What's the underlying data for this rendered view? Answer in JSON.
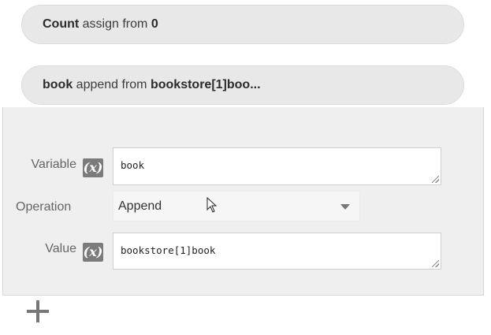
{
  "statements": [
    {
      "variable": "Count",
      "verb": "assign from",
      "source": "0"
    },
    {
      "variable": "book",
      "verb": "append from",
      "source": "bookstore[1]boo..."
    }
  ],
  "editor": {
    "variable_label": "Variable",
    "variable_value": "book",
    "operation_label": "Operation",
    "operation_value": "Append",
    "value_label": "Value",
    "value_value": "bookstore[1]book",
    "expr_icon": "(x)"
  },
  "icons": {
    "expression": "function-x-icon",
    "dropdown": "chevron-down-icon",
    "add": "plus-icon",
    "cursor": "mouse-pointer-icon"
  },
  "colors": {
    "pill_bg": "#e8e8e8",
    "panel_bg": "#efefef",
    "icon_bg": "#7b7b7b"
  }
}
